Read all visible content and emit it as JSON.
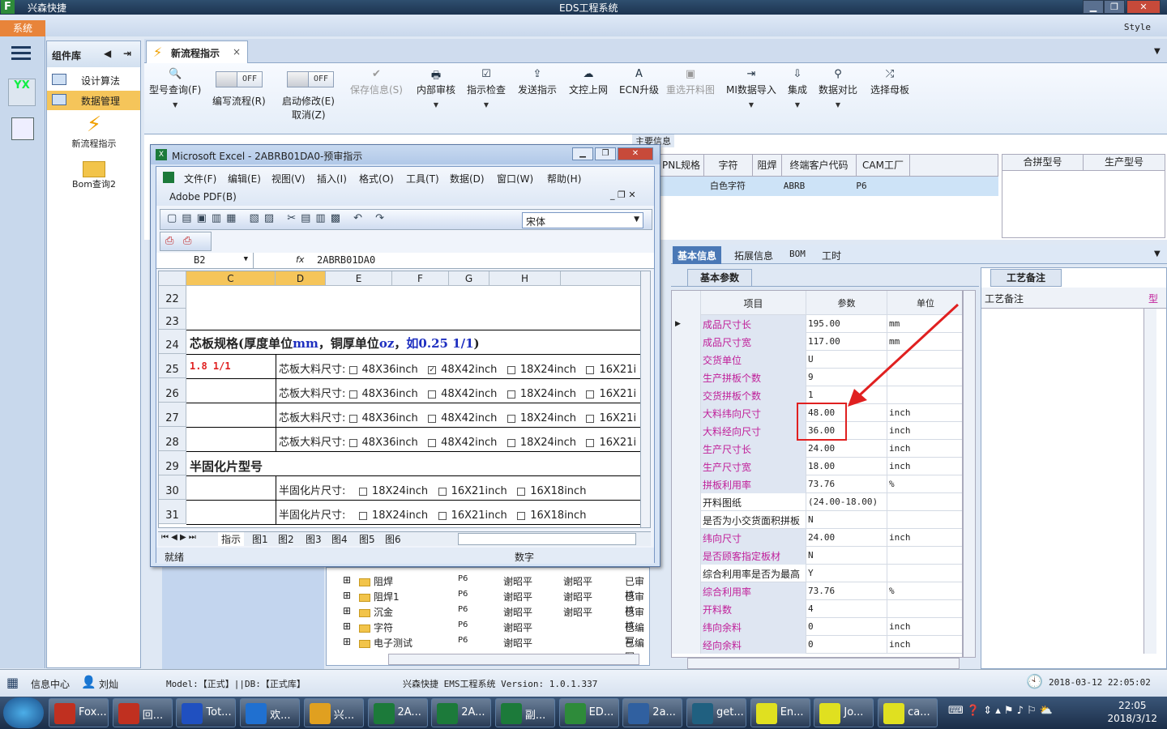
{
  "titlebar": {
    "left": "兴森快捷",
    "center": "EDS工程系统"
  },
  "menubar": {
    "system": "系统",
    "style": "Style"
  },
  "component_panel": {
    "header": "组件库",
    "items": [
      {
        "label": "设计算法"
      },
      {
        "label": "数据管理"
      }
    ],
    "icons": [
      {
        "label": "新流程指示"
      },
      {
        "label": "Bom查询2"
      }
    ]
  },
  "doc_tab": {
    "label": "新流程指示",
    "close": "×"
  },
  "ribbon": {
    "buttons": [
      {
        "label": "型号查询(F)",
        "glyph": "🔍"
      },
      {
        "label": "保存信息(S)",
        "glyph": "✔"
      },
      {
        "label": "内部审核",
        "glyph": "🖶"
      },
      {
        "label": "指示检查",
        "glyph": "☑"
      },
      {
        "label": "发送指示",
        "glyph": "⇪"
      },
      {
        "label": "文控上网",
        "glyph": "☁"
      },
      {
        "label": "ECN升级",
        "glyph": "A"
      },
      {
        "label": "重选开料图",
        "glyph": "▣"
      },
      {
        "label": "MI数据导入",
        "glyph": "⇥"
      },
      {
        "label": "集成",
        "glyph": "⇩"
      },
      {
        "label": "数据对比",
        "glyph": "⚲"
      },
      {
        "label": "选择母板",
        "glyph": "⤮"
      }
    ],
    "toggles": [
      {
        "state": "OFF",
        "label": "编写流程(R)"
      },
      {
        "state": "OFF",
        "label": "启动修改(E)",
        "sub": "取消(Z)"
      }
    ]
  },
  "main_info": {
    "tab": "主要信息",
    "columns": [
      "PNL规格",
      "字符",
      "阻焊",
      "终端客户代码",
      "CAM工厂"
    ],
    "row": [
      "",
      "白色字符",
      "ABRB",
      "P6",
      ""
    ],
    "right_columns": [
      "合拼型号",
      "生产型号"
    ]
  },
  "right_panel": {
    "tabs": [
      "基本信息",
      "拓展信息",
      "BOM",
      "工时"
    ],
    "subtab": "基本参数",
    "process_tab": "工艺备注",
    "process_col": "工艺备注",
    "process_col2": "型",
    "headers": [
      "项目",
      "参数",
      "单位"
    ],
    "rows": [
      {
        "item": "成品尺寸长",
        "value": "195.00",
        "unit": "mm",
        "hl": true
      },
      {
        "item": "成品尺寸宽",
        "value": "117.00",
        "unit": "mm",
        "hl": true
      },
      {
        "item": "交货单位",
        "value": "U",
        "unit": "",
        "hl": true
      },
      {
        "item": "生产拼板个数",
        "value": "9",
        "unit": "",
        "hl": true
      },
      {
        "item": "交货拼板个数",
        "value": "1",
        "unit": "",
        "hl": true
      },
      {
        "item": "大料纬向尺寸",
        "value": "48.00",
        "unit": "inch",
        "hl": true
      },
      {
        "item": "大料经向尺寸",
        "value": "36.00",
        "unit": "inch",
        "hl": true
      },
      {
        "item": "生产尺寸长",
        "value": "24.00",
        "unit": "inch",
        "hl": true
      },
      {
        "item": "生产尺寸宽",
        "value": "18.00",
        "unit": "inch",
        "hl": true
      },
      {
        "item": "拼板利用率",
        "value": "73.76",
        "unit": "%",
        "hl": true
      },
      {
        "item": "开料图纸",
        "value": "(24.00-18.00)",
        "unit": "",
        "hl": false
      },
      {
        "item": "是否为小交货面积拼板",
        "value": "N",
        "unit": "",
        "hl": false
      },
      {
        "item": "纬向尺寸",
        "value": "24.00",
        "unit": "inch",
        "hl": true
      },
      {
        "item": "是否顾客指定板材",
        "value": "N",
        "unit": "",
        "hl": true
      },
      {
        "item": "综合利用率是否为最高",
        "value": "Y",
        "unit": "",
        "hl": false
      },
      {
        "item": "综合利用率",
        "value": "73.76",
        "unit": "%",
        "hl": true
      },
      {
        "item": "开料数",
        "value": "4",
        "unit": "",
        "hl": true
      },
      {
        "item": "纬向余料",
        "value": "0",
        "unit": "inch",
        "hl": true
      },
      {
        "item": "经向余料",
        "value": "0",
        "unit": "inch",
        "hl": true
      }
    ]
  },
  "tree_rows": [
    {
      "name": "阻焊",
      "code": "P6",
      "a": "谢昭平",
      "b": "谢昭平",
      "s": "已审核"
    },
    {
      "name": "阻焊1",
      "code": "P6",
      "a": "谢昭平",
      "b": "谢昭平",
      "s": "已审核"
    },
    {
      "name": "沉金",
      "code": "P6",
      "a": "谢昭平",
      "b": "谢昭平",
      "s": "已审核"
    },
    {
      "name": "字符",
      "code": "P6",
      "a": "谢昭平",
      "b": "",
      "s": "已编写"
    },
    {
      "name": "电子测试",
      "code": "P6",
      "a": "谢昭平",
      "b": "",
      "s": "已编写"
    }
  ],
  "excel": {
    "title": "Microsoft Excel - 2ABRB01DA0-预审指示",
    "menus": [
      "文件(F)",
      "编辑(E)",
      "视图(V)",
      "插入(I)",
      "格式(O)",
      "工具(T)",
      "数据(D)",
      "窗口(W)",
      "帮助(H)"
    ],
    "menu2": "Adobe PDF(B)",
    "font": "宋体",
    "namebox": "B2",
    "formula": "2ABRB01DA0",
    "fx": "fx",
    "cols": [
      "C",
      "D",
      "E",
      "F",
      "G",
      "H"
    ],
    "rows": [
      "22",
      "23",
      "24",
      "25",
      "26",
      "27",
      "28",
      "29",
      "30",
      "31"
    ],
    "r24": "芯板规格(厚度单位",
    "r24_mm": "mm",
    "r24_b": "，铜厚单位",
    "r24_oz": "oz",
    "r24_c": "，",
    "r24_eg": "如0.25 1/1",
    "r24_d": ")",
    "r25_val": "1.8 1/1",
    "core_label": "芯板大料尺寸:",
    "core_opts": [
      "48X36inch",
      "48X42inch",
      "18X24inch",
      "16X21i"
    ],
    "r29": "半固化片型号",
    "pp_label": "半固化片尺寸:",
    "pp_opts": [
      "18X24inch",
      "16X21inch",
      "16X18inch"
    ],
    "sheets": [
      "指示",
      "图1",
      "图2",
      "图3",
      "图4",
      "图5",
      "图6"
    ],
    "status_left": "就绪",
    "status_mid": "数字"
  },
  "statusbar": {
    "info": "信息中心",
    "user": "刘灿",
    "model": "Model:【正式】||DB:【正式库】",
    "version": "兴森快捷 EMS工程系统 Version: 1.0.1.337",
    "datetime": "2018-03-12 22:05:02"
  },
  "taskbar": {
    "items": [
      "Fox...",
      "回...",
      "Tot...",
      "欢...",
      "兴...",
      "2A...",
      "2A...",
      "副...",
      "ED...",
      "2a...",
      "get...",
      "En...",
      "Jo...",
      "ca..."
    ],
    "time": "22:05",
    "date": "2018/3/12"
  }
}
